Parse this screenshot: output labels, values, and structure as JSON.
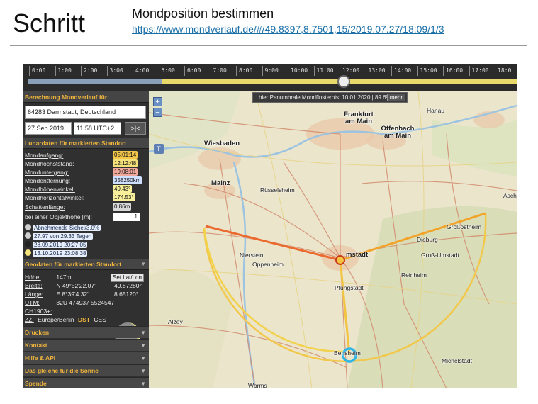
{
  "slide": {
    "step_title": "Schritt",
    "heading": "Mondposition bestimmen",
    "link": "https://www.mondverlauf.de/#/49.8397,8.7501,15/2019.07.27/18:09/1/3"
  },
  "timeline": {
    "hours": [
      "0:00",
      "1:00",
      "2:00",
      "3:00",
      "4:00",
      "5:00",
      "6:00",
      "7:00",
      "8:00",
      "9:00",
      "10:00",
      "11:00",
      "12:00",
      "13:00",
      "14:00",
      "15:00",
      "16:00",
      "17:00",
      "18:0"
    ]
  },
  "sidebar": {
    "calc_header": "Berechnung Mondverlauf für:",
    "location": "64283 Darmstadt, Deutschland",
    "date": "27.Sep.2019",
    "time": "11:58 UTC+2",
    "go_label": ">|<",
    "lunar_header": "Lunardaten für markierten Standort",
    "lunar": [
      {
        "label": "Mondaufgang:",
        "value": "05:01:14",
        "color": "#f3c74a"
      },
      {
        "label": "Mondhöchststand:",
        "value": "12:12:48",
        "color": "#f3e07a"
      },
      {
        "label": "Monduntergang:",
        "value": "19:08:01",
        "color": "#f2a99c"
      },
      {
        "label": "Mondentfernung:",
        "value": "358250km",
        "color": "#cfe0ff"
      },
      {
        "label": "Mondhöhenwinkel:",
        "value": "49.43°",
        "color": "#f7ef9a"
      },
      {
        "label": "Mondhorizontalwinkel:",
        "value": "174.53°",
        "color": "#f7ef9a"
      }
    ],
    "shadow_label": "Schattenlänge:",
    "shadow_value": "0.86m",
    "object_label": "bei einer Objekthöhe [m]:",
    "object_value": "1",
    "phases": [
      {
        "text": "Abnehmende Sichel/3.0%",
        "dot": "#cfcfcf"
      },
      {
        "text": "27.97 von 29.33 Tagen",
        "dot": "#cfcfcf"
      },
      {
        "text": "28.09.2019 20:27:05",
        "dot": "#222222"
      },
      {
        "text": "13.10.2019 23:08:38",
        "dot": "#f4e27a"
      }
    ],
    "geo_header": "Geodaten für markierten Standort",
    "geo": {
      "hoehe_label": "Höhe:",
      "hoehe": "147m",
      "breite_label": "Breite:",
      "breite": "N 49°52'22.07\"",
      "breite_dec": "49.87280°",
      "laenge_label": "Länge:",
      "laenge": "E 8°39'4.32\"",
      "laenge_dec": "8.65120°",
      "utm_label": "UTM:",
      "utm": "32U 474937 5524547",
      "ch_label": "CH1903+:",
      "ch": "...",
      "zz_label": "ZZ:",
      "zz": "Europe/Berlin",
      "dst": "DST",
      "cest": "CEST",
      "set_btn": "Set Lat/Lon"
    },
    "menu": [
      "Drucken",
      "Kontakt",
      "Hilfe & API",
      "Das gleiche für die Sonne",
      "Spende"
    ]
  },
  "map": {
    "eclipse_text": "hier Penumbrale Mondfinsternis: 10.01.2020 | 89.6%",
    "eclipse_more": "mehr",
    "t_button": "T",
    "labels": [
      {
        "text": "Frankfurt am Main",
        "big": true
      },
      {
        "text": "Offenbach am Main",
        "big": true
      },
      {
        "text": "Hanau",
        "big": false
      },
      {
        "text": "Wiesbaden",
        "big": true
      },
      {
        "text": "Mainz",
        "big": true
      },
      {
        "text": "Rüsselsheim",
        "big": false
      },
      {
        "text": "Aschaffenb",
        "big": false
      },
      {
        "text": "Dieburg",
        "big": false
      },
      {
        "text": "Groß-Umstadt",
        "big": false
      },
      {
        "text": "Großostheim",
        "big": false
      },
      {
        "text": "Nierstein",
        "big": false
      },
      {
        "text": "Oppenheim",
        "big": false
      },
      {
        "text": "Pfungstadt",
        "big": false
      },
      {
        "text": "Reinheim",
        "big": false
      },
      {
        "text": "Alzey",
        "big": false
      },
      {
        "text": "Bensheim",
        "big": false
      },
      {
        "text": "Michelstadt",
        "big": false
      },
      {
        "text": "Worms",
        "big": false
      },
      {
        "text": "mstadt",
        "big": true
      }
    ]
  }
}
